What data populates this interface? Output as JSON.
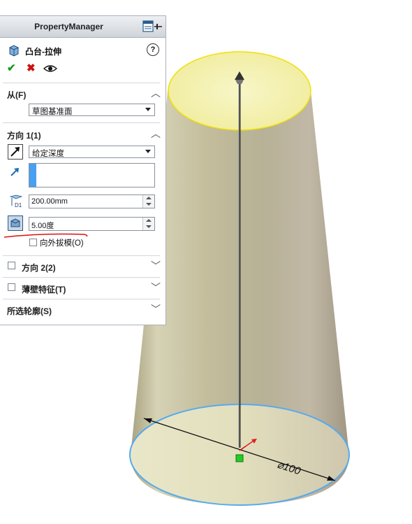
{
  "panel": {
    "title": "PropertyManager",
    "feature_name": "凸台-拉伸",
    "help": "?"
  },
  "sections": {
    "from": {
      "label": "从(F)",
      "value": "草图基准面"
    },
    "direction1": {
      "label": "方向 1(1)",
      "end_condition": "给定深度",
      "depth": "200.00mm",
      "draft_angle": "5.00度",
      "draft_outward_label": "向外拔模(O)"
    },
    "direction2": {
      "label": "方向 2(2)"
    },
    "thin_feature": {
      "label": "薄壁特征(T)"
    },
    "selected_contours": {
      "label": "所选轮廓(S)"
    }
  },
  "model": {
    "dimension_label": "⌀100",
    "colors": {
      "body": "#bfb99f",
      "top_face": "#f5f0a0",
      "top_edge": "#f0e000",
      "bottom_edge": "#55aaee",
      "accent": "#4aa0f0"
    }
  }
}
